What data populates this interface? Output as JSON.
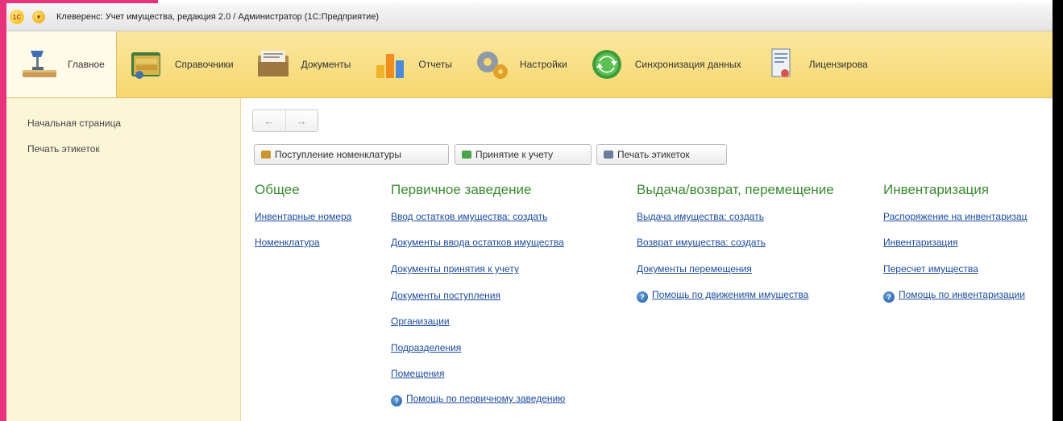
{
  "window": {
    "logo_text": "1С",
    "menu_glyph": "▾",
    "title": "Клеверенс: Учет имущества, редакция 2.0 / Администратор  (1С:Предприятие)"
  },
  "sections": [
    {
      "label": "Главное",
      "icon": "desk-lamp-icon",
      "active": true
    },
    {
      "label": "Справочники",
      "icon": "folders-icon"
    },
    {
      "label": "Документы",
      "icon": "documents-box-icon"
    },
    {
      "label": "Отчеты",
      "icon": "bar-chart-icon"
    },
    {
      "label": "Настройки",
      "icon": "gears-icon"
    },
    {
      "label": "Синхронизация данных",
      "icon": "sync-icon"
    },
    {
      "label": "Лицензирова",
      "icon": "license-icon"
    }
  ],
  "sidebar": {
    "items": [
      {
        "label": "Начальная страница"
      },
      {
        "label": "Печать этикеток"
      }
    ]
  },
  "nav": {
    "back": "←",
    "forward": "→"
  },
  "commands": [
    {
      "label": "Поступление номенклатуры",
      "icon": "receipt-icon"
    },
    {
      "label": "Принятие к учету",
      "icon": "accept-icon"
    },
    {
      "label": "Печать этикеток",
      "icon": "printer-icon"
    }
  ],
  "groups": {
    "general": {
      "title": "Общее",
      "links": [
        "Инвентарные номера",
        "Номенклатура"
      ]
    },
    "primary": {
      "title": "Первичное заведение",
      "links": [
        "Ввод остатков имущества: создать",
        "Документы ввода остатков имущества",
        "Документы принятия к учету",
        "Документы поступления",
        "Организации",
        "Подразделения",
        "Помещения"
      ],
      "help": "Помощь по первичному заведению"
    },
    "issue": {
      "title": "Выдача/возврат, перемещение",
      "links": [
        "Выдача имущества: создать",
        "Возврат имущества: создать",
        "Документы перемещения"
      ],
      "help": "Помощь по движениям имущества"
    },
    "inventory": {
      "title": "Инвентаризация",
      "links": [
        "Распоряжение на инвентаризац",
        "Инвентаризация",
        "Пересчет имущества"
      ],
      "help": "Помощь по инвентаризации"
    }
  },
  "help_glyph": "?",
  "colors": {
    "accent_frame": "#e8327c",
    "section_bar": "#f6d770",
    "sidebar_bg": "#fbf6d7",
    "group_title": "#3a8a30",
    "link": "#1c4a9c"
  }
}
